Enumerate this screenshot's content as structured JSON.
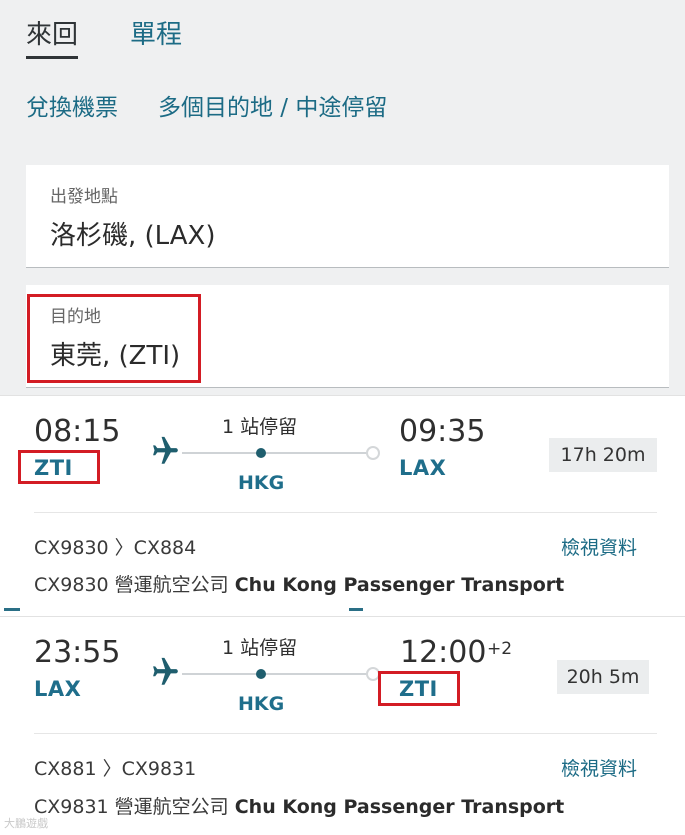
{
  "trip_tabs": {
    "round_trip": "來回",
    "one_way": "單程"
  },
  "links": {
    "redeem": "兌換機票",
    "multi_city": "多個目的地 / 中途停留"
  },
  "origin": {
    "label": "出發地點",
    "value": "洛杉磯, (LAX)"
  },
  "destination": {
    "label": "目的地",
    "value": "東莞, (ZTI)"
  },
  "flights": [
    {
      "depart_time": "08:15",
      "depart_code": "ZTI",
      "stops": "1 站停留",
      "hub": "HKG",
      "arrive_time": "09:35",
      "arrive_plus": "",
      "arrive_code": "LAX",
      "duration": "17h 20m",
      "flight_numbers": "CX9830 〉CX884",
      "details_link": "檢視資料",
      "operator_prefix": "CX9830 營運航空公司 ",
      "operator_name": "Chu Kong Passenger Transport"
    },
    {
      "depart_time": "23:55",
      "depart_code": "LAX",
      "stops": "1 站停留",
      "hub": "HKG",
      "arrive_time": "12:00",
      "arrive_plus": "+2",
      "arrive_code": "ZTI",
      "duration": "20h 5m",
      "flight_numbers": "CX881 〉CX9831",
      "details_link": "檢視資料",
      "operator_prefix": "CX9831 營運航空公司 ",
      "operator_name": "Chu Kong Passenger Transport"
    }
  ],
  "watermark": "大鵬遊戲",
  "colors": {
    "accent": "#1c6b85",
    "highlight": "#d31c24",
    "form_bg": "#eff0f1"
  },
  "icons": {
    "plane": "plane-icon"
  }
}
